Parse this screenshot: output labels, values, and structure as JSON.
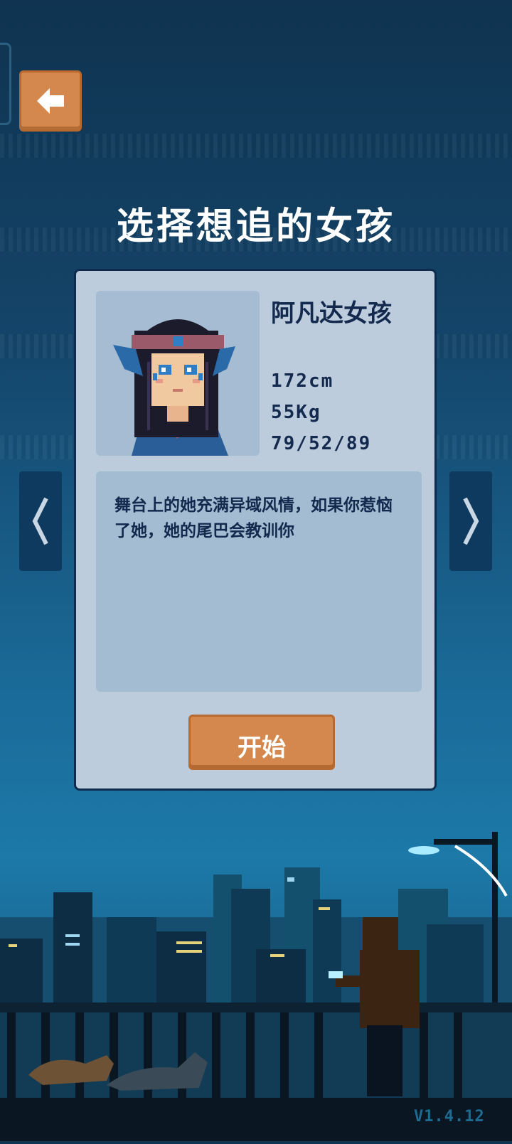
{
  "screen": {
    "title": "选择想追的女孩",
    "version": "V1.4.12"
  },
  "character": {
    "name": "阿凡达女孩",
    "height": "172cm",
    "weight": "55Kg",
    "measurements": "79/52/89",
    "description": "舞台上的她充满异域风情，如果你惹恼了她，她的尾巴会教训你"
  },
  "buttons": {
    "start_label": "开始",
    "back_icon": "arrow-left-icon",
    "prev_icon": "chevron-left-icon",
    "next_icon": "chevron-right-icon"
  },
  "colors": {
    "accent": "#d4884d",
    "card": "#bcccdc",
    "text_dark": "#13294d"
  }
}
